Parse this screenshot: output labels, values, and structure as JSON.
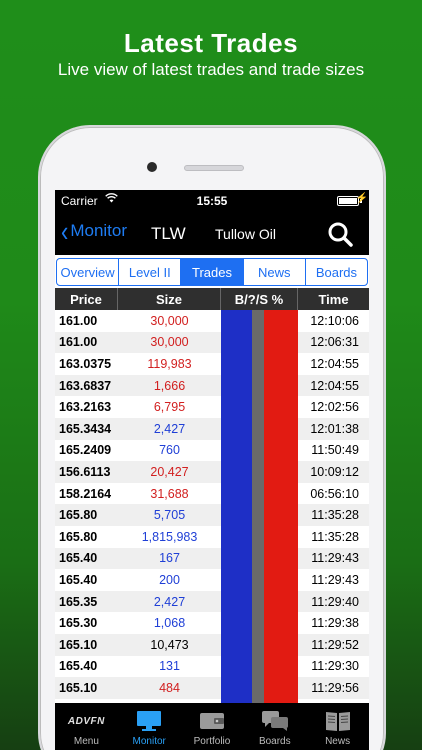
{
  "promo": {
    "title": "Latest Trades",
    "subtitle": "Live view of latest trades and trade sizes"
  },
  "status": {
    "carrier": "Carrier",
    "time": "15:55"
  },
  "nav": {
    "back_label": "Monitor",
    "symbol": "TLW",
    "company": "Tullow Oil"
  },
  "tabs": [
    "Overview",
    "Level II",
    "Trades",
    "News",
    "Boards"
  ],
  "active_tab": "Trades",
  "table": {
    "headers": {
      "price": "Price",
      "size": "Size",
      "bs": "B/?/S %",
      "time": "Time"
    },
    "rows": [
      {
        "price": "161.00",
        "size": "30,000",
        "side": "sell",
        "time": "12:10:06"
      },
      {
        "price": "161.00",
        "size": "30,000",
        "side": "sell",
        "time": "12:06:31"
      },
      {
        "price": "163.0375",
        "size": "119,983",
        "side": "sell",
        "time": "12:04:55"
      },
      {
        "price": "163.6837",
        "size": "1,666",
        "side": "sell",
        "time": "12:04:55"
      },
      {
        "price": "163.2163",
        "size": "6,795",
        "side": "sell",
        "time": "12:02:56"
      },
      {
        "price": "165.3434",
        "size": "2,427",
        "side": "buy",
        "time": "12:01:38"
      },
      {
        "price": "165.2409",
        "size": "760",
        "side": "buy",
        "time": "11:50:49"
      },
      {
        "price": "156.6113",
        "size": "20,427",
        "side": "sell",
        "time": "10:09:12"
      },
      {
        "price": "158.2164",
        "size": "31,688",
        "side": "sell",
        "time": "06:56:10"
      },
      {
        "price": "165.80",
        "size": "5,705",
        "side": "buy",
        "time": "11:35:28"
      },
      {
        "price": "165.80",
        "size": "1,815,983",
        "side": "buy",
        "time": "11:35:28"
      },
      {
        "price": "165.40",
        "size": "167",
        "side": "buy",
        "time": "11:29:43"
      },
      {
        "price": "165.40",
        "size": "200",
        "side": "buy",
        "time": "11:29:43"
      },
      {
        "price": "165.35",
        "size": "2,427",
        "side": "buy",
        "time": "11:29:40"
      },
      {
        "price": "165.30",
        "size": "1,068",
        "side": "buy",
        "time": "11:29:38"
      },
      {
        "price": "165.10",
        "size": "10,473",
        "side": "neutral",
        "time": "11:29:52"
      },
      {
        "price": "165.40",
        "size": "131",
        "side": "buy",
        "time": "11:29:30"
      },
      {
        "price": "165.10",
        "size": "484",
        "side": "sell",
        "time": "11:29:56"
      }
    ]
  },
  "bs_percent": {
    "buy": 40,
    "unknown": 16,
    "sell": 44
  },
  "colors": {
    "buy": "#1f3fd6",
    "sell": "#d22020",
    "accent": "#1e6ff2",
    "bg_green": "#1f8e1a"
  },
  "tabbar": [
    {
      "label": "Menu",
      "icon": "advfn-logo-icon",
      "logo_text": "ADVFN"
    },
    {
      "label": "Monitor",
      "icon": "monitor-icon"
    },
    {
      "label": "Portfolio",
      "icon": "wallet-icon"
    },
    {
      "label": "Boards",
      "icon": "chat-bubbles-icon"
    },
    {
      "label": "News",
      "icon": "newspaper-icon"
    }
  ],
  "active_tabbar": "Monitor"
}
